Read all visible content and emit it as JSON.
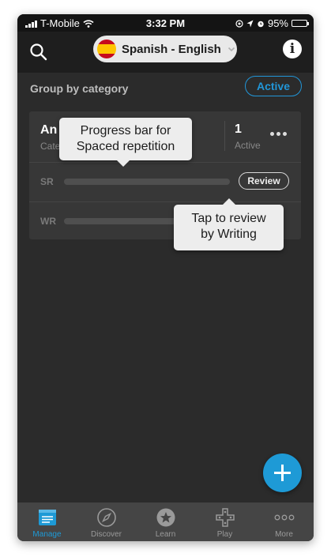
{
  "status_bar": {
    "carrier": "T-Mobile",
    "time": "3:32 PM",
    "battery": "95%",
    "battery_level": 0.95
  },
  "header": {
    "language_pair": "Spanish - English",
    "search_icon": "search-icon",
    "info_icon": "info-icon",
    "info_glyph": "i"
  },
  "group": {
    "label": "Group by category",
    "filter": "Active"
  },
  "card": {
    "title": "An",
    "subtitle": "Cate",
    "active_count": "1",
    "active_label": "Active",
    "rows": [
      {
        "label": "SR",
        "progress": 0,
        "action": "Review"
      },
      {
        "label": "WR",
        "progress": 0,
        "action": ""
      }
    ]
  },
  "tooltips": {
    "sr": [
      "Progress bar for",
      "Spaced repetition"
    ],
    "wr": [
      "Tap to review",
      "by Writing"
    ]
  },
  "fab": {
    "icon": "plus-icon"
  },
  "tabs": [
    {
      "label": "Manage",
      "icon": "manage-icon",
      "selected": true
    },
    {
      "label": "Discover",
      "icon": "compass-icon",
      "selected": false
    },
    {
      "label": "Learn",
      "icon": "star-badge-icon",
      "selected": false
    },
    {
      "label": "Play",
      "icon": "gamepad-icon",
      "selected": false
    },
    {
      "label": "More",
      "icon": "more-dots-icon",
      "selected": false
    }
  ],
  "colors": {
    "accent": "#1e9ad6",
    "background": "#2b2b2b",
    "card": "#373737",
    "tab_bar": "#454545"
  }
}
